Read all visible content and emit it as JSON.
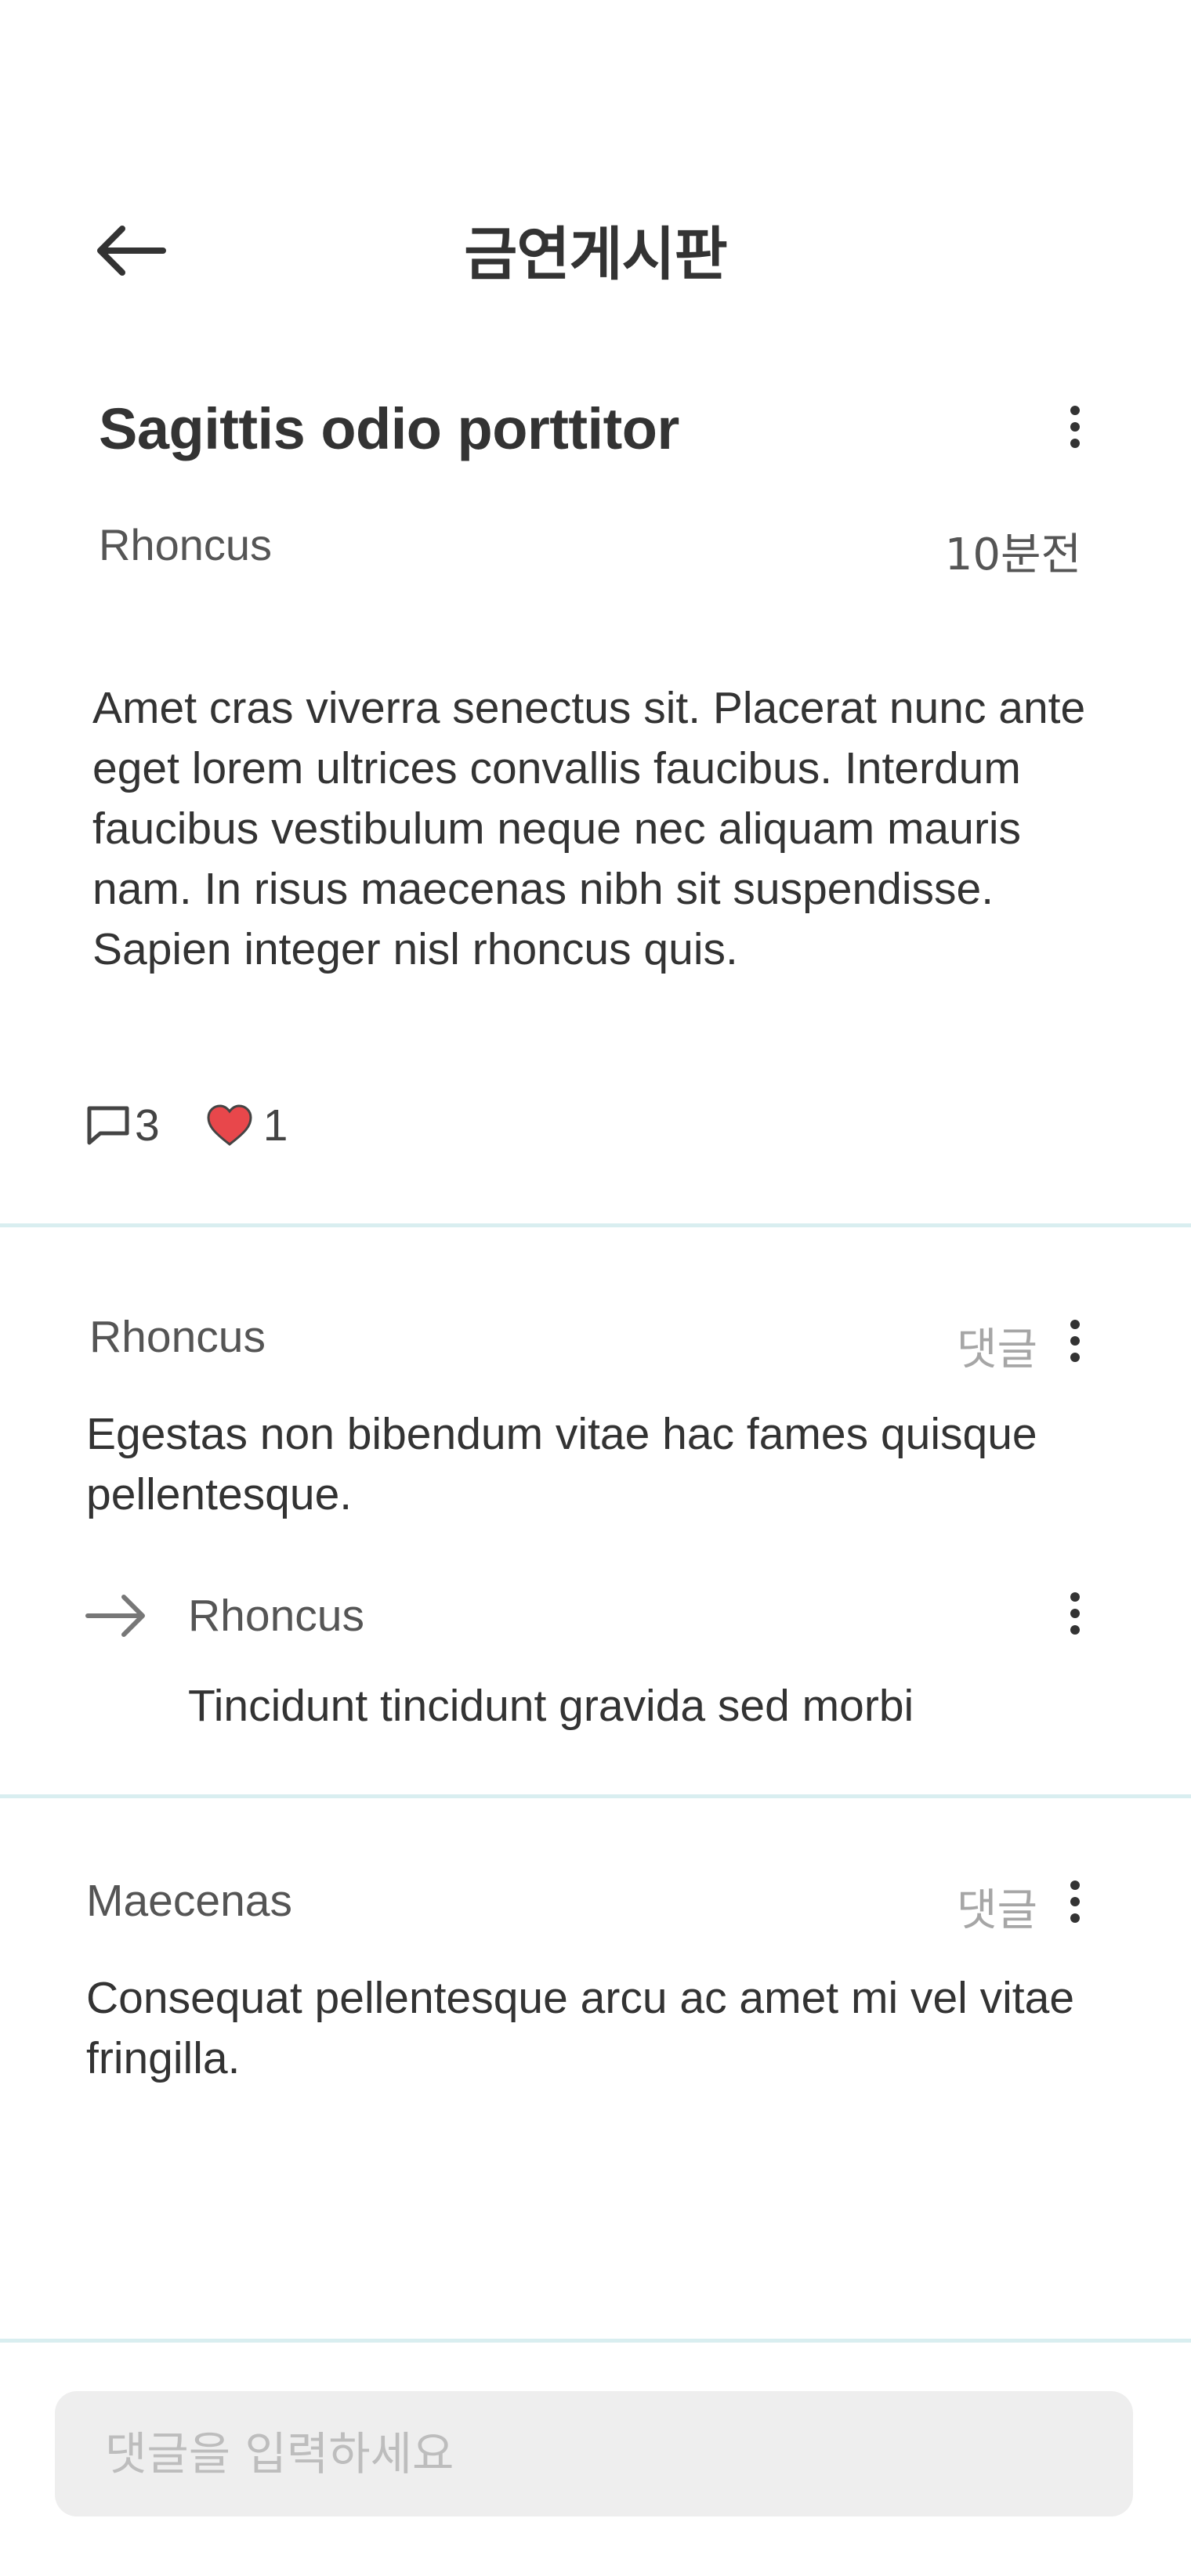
{
  "header": {
    "title": "금연게시판"
  },
  "post": {
    "title": "Sagittis odio porttitor",
    "author": "Rhoncus",
    "time": "10분전",
    "body": "Amet cras viverra senectus sit. Placerat nunc ante eget lorem ultrices convallis faucibus. Interdum faucibus vestibulum neque nec aliquam mauris nam. In risus maecenas nibh sit suspendisse. Sapien integer nisl rhoncus quis.",
    "comment_count": "3",
    "like_count": "1"
  },
  "comments": [
    {
      "author": "Rhoncus",
      "reply_label": "댓글",
      "body": "Egestas non bibendum vitae hac fames quisque pellentesque.",
      "replies": [
        {
          "author": "Rhoncus",
          "body": "Tincidunt tincidunt gravida sed morbi"
        }
      ]
    },
    {
      "author": "Maecenas",
      "reply_label": "댓글",
      "body": "Consequat pellentesque arcu ac amet mi vel vitae fringilla."
    }
  ],
  "comment_input": {
    "placeholder": "댓글을 입력하세요",
    "value": ""
  },
  "colors": {
    "divider": "#d9eef0",
    "heart": "#e8474b",
    "input_bg": "#eeeeee"
  },
  "icons": [
    "arrow-left-icon",
    "more-vertical-icon",
    "comment-icon",
    "heart-icon",
    "reply-arrow-icon"
  ]
}
